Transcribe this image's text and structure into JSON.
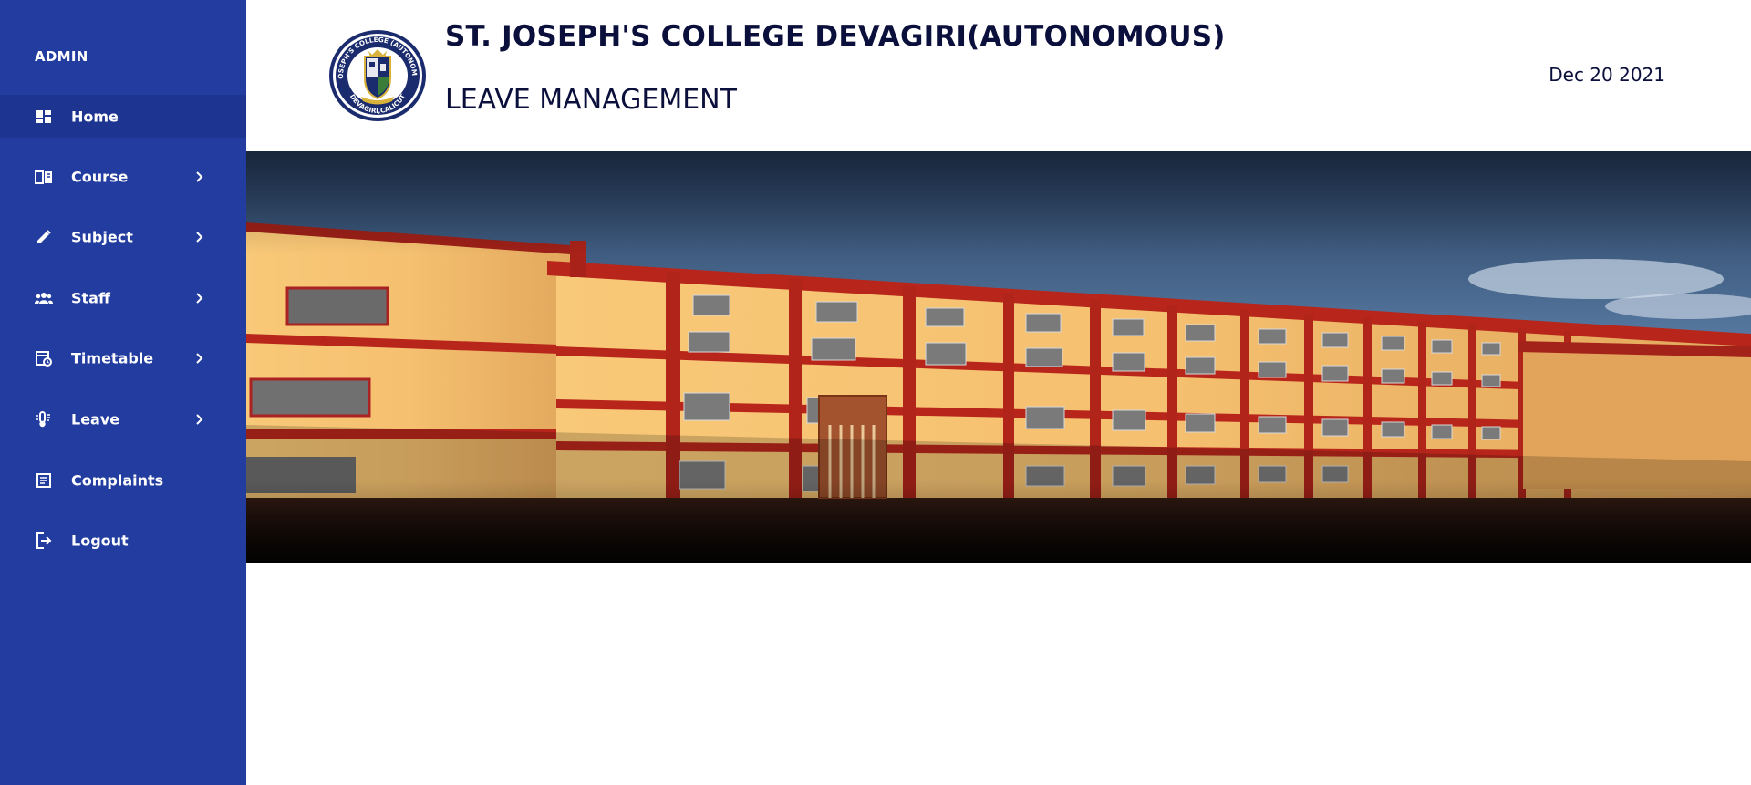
{
  "sidebar": {
    "brand": "ADMIN",
    "items": [
      {
        "label": "Home",
        "icon": "dashboard-icon",
        "active": true,
        "chevron": false
      },
      {
        "label": "Course",
        "icon": "book-icon",
        "active": false,
        "chevron": true
      },
      {
        "label": "Subject",
        "icon": "pencil-icon",
        "active": false,
        "chevron": true
      },
      {
        "label": "Staff",
        "icon": "people-icon",
        "active": false,
        "chevron": true
      },
      {
        "label": "Timetable",
        "icon": "schedule-icon",
        "active": false,
        "chevron": true
      },
      {
        "label": "Leave",
        "icon": "leave-icon",
        "active": false,
        "chevron": true
      },
      {
        "label": "Complaints",
        "icon": "list-icon",
        "active": false,
        "chevron": false
      },
      {
        "label": "Logout",
        "icon": "logout-icon",
        "active": false,
        "chevron": false
      }
    ]
  },
  "header": {
    "college_name": "ST. JOSEPH'S COLLEGE DEVAGIRI(AUTONOMOUS)",
    "app_name": "LEAVE MANAGEMENT",
    "date": "Dec 20 2021",
    "logo_text_top": "ST. JOSEPH'S COLLEGE (AUTONOMOUS)",
    "logo_text_bottom": "DEVAGIRI,CALICUT"
  },
  "colors": {
    "sidebar_bg": "#233c9f",
    "sidebar_active": "#1d3491",
    "title_text": "#0b0f3b",
    "building_wall": "#f6c36a",
    "building_trim": "#b8261b"
  }
}
